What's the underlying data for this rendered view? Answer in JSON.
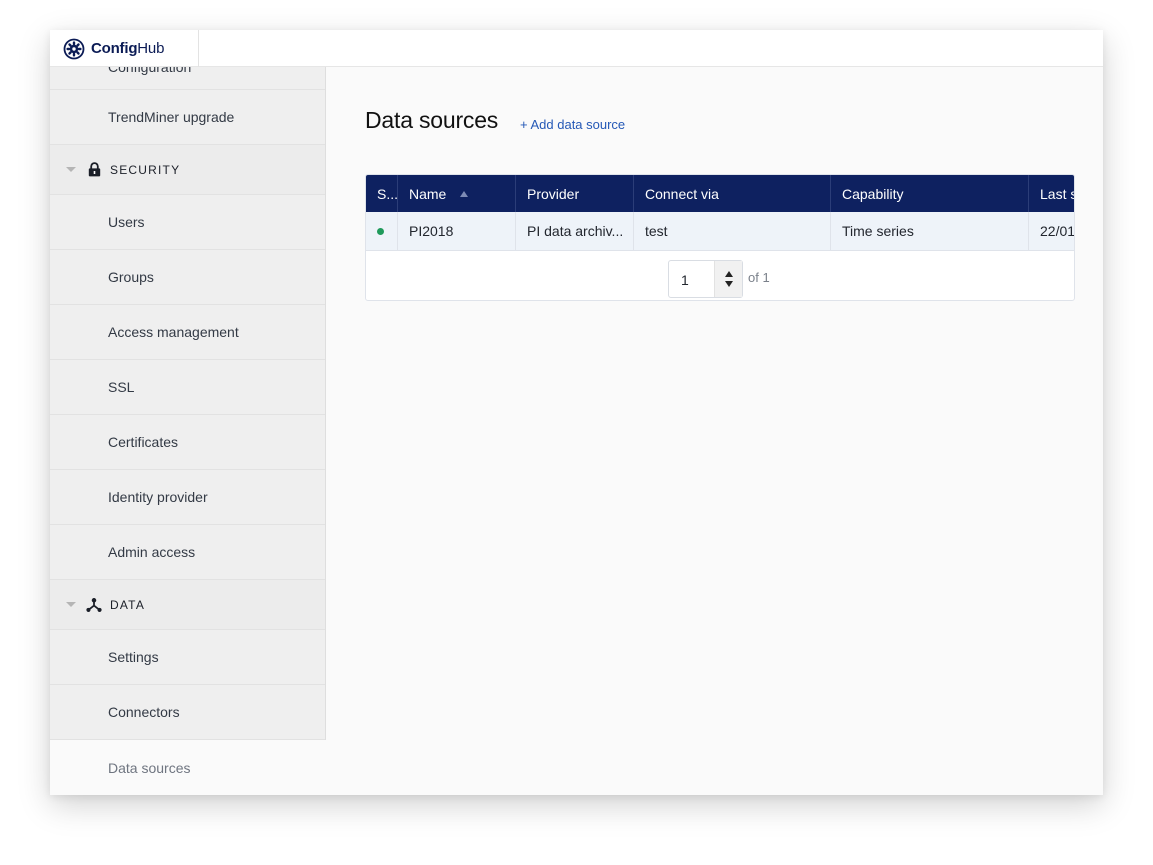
{
  "brand": {
    "name_bold": "Config",
    "name_light": "Hub"
  },
  "sidebar": {
    "partial_item": "Configuration",
    "rows": [
      {
        "type": "item",
        "label": "TrendMiner upgrade",
        "name": "sidebar-item-trendminer-upgrade"
      },
      {
        "type": "section",
        "label": "SECURITY",
        "icon": "lock-icon",
        "name": "sidebar-section-security"
      },
      {
        "type": "item",
        "label": "Users",
        "name": "sidebar-item-users"
      },
      {
        "type": "item",
        "label": "Groups",
        "name": "sidebar-item-groups"
      },
      {
        "type": "item",
        "label": "Access management",
        "name": "sidebar-item-access-management"
      },
      {
        "type": "item",
        "label": "SSL",
        "name": "sidebar-item-ssl"
      },
      {
        "type": "item",
        "label": "Certificates",
        "name": "sidebar-item-certificates"
      },
      {
        "type": "item",
        "label": "Identity provider",
        "name": "sidebar-item-identity-provider"
      },
      {
        "type": "item",
        "label": "Admin access",
        "name": "sidebar-item-admin-access"
      },
      {
        "type": "section",
        "label": "DATA",
        "icon": "data-nodes-icon",
        "name": "sidebar-section-data"
      },
      {
        "type": "item",
        "label": "Settings",
        "name": "sidebar-item-settings"
      },
      {
        "type": "item",
        "label": "Connectors",
        "name": "sidebar-item-connectors"
      },
      {
        "type": "item",
        "label": "Data sources",
        "name": "sidebar-item-data-sources",
        "active": true
      }
    ]
  },
  "main": {
    "title": "Data sources",
    "add_label": "+ Add data source",
    "table": {
      "columns": [
        "S...",
        "Name",
        "Provider",
        "Connect via",
        "Capability",
        "Last s"
      ],
      "sorted_column": "Name",
      "rows": [
        {
          "status": "ok",
          "name": "PI2018",
          "provider": "PI data archiv...",
          "connect_via": "test",
          "capability": "Time series",
          "last": "22/01"
        }
      ]
    },
    "pager": {
      "page": "1",
      "of_label": "of 1"
    }
  },
  "colors": {
    "header_bg": "#0e2160",
    "accent_link": "#2458b6",
    "status_ok": "#1f9a5b",
    "brand": "#0b1b55"
  }
}
